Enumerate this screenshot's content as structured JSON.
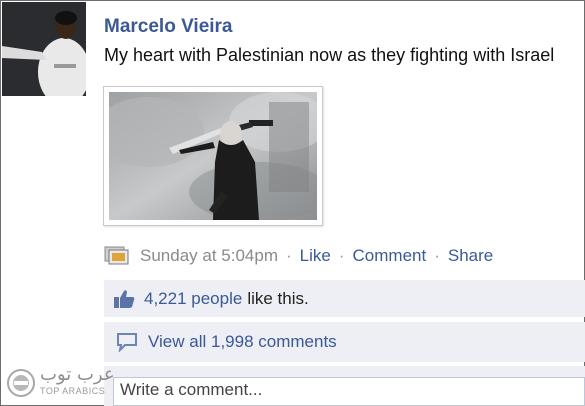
{
  "post": {
    "author": "Marcelo Vieira",
    "message": "My heart with Palestinian now as they fighting with Israel",
    "timestamp": "Sunday at 5:04pm",
    "actions": {
      "like": "Like",
      "comment": "Comment",
      "share": "Share"
    },
    "likes": {
      "count": "4,221 people",
      "suffix": "like this."
    },
    "comments_link": "View all 1,998 comments",
    "comment_placeholder": "Write a comment..."
  },
  "watermark": {
    "arabic": "عرب توب",
    "english": "TOP ARABICS"
  },
  "colors": {
    "link": "#3b5998",
    "panel": "#edeff4",
    "meta_text": "#8a8a8a"
  }
}
